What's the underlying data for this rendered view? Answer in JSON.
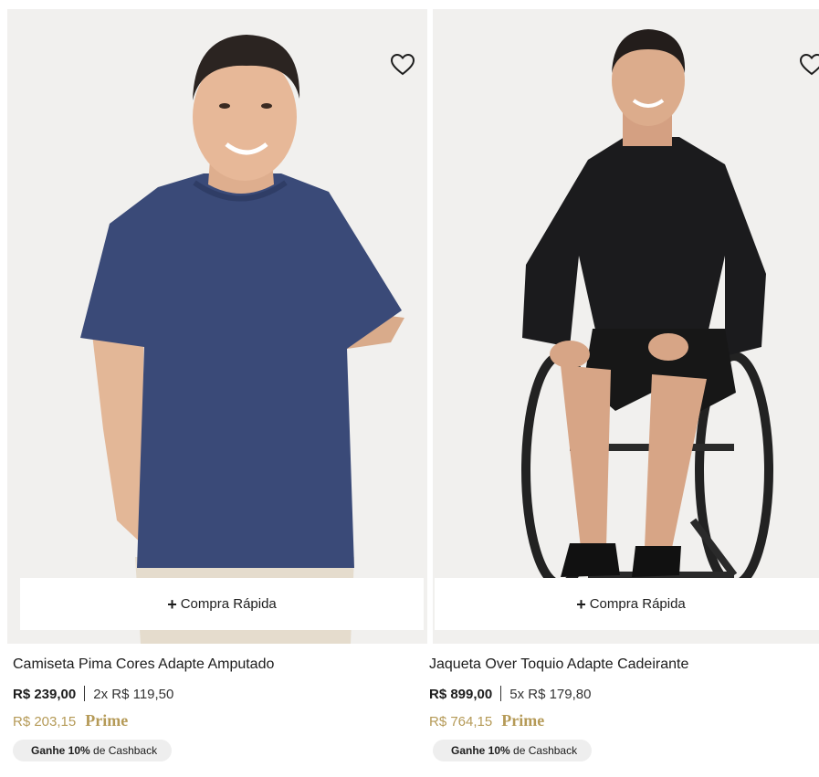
{
  "products": [
    {
      "name": "Camiseta Pima Cores Adapte Amputado",
      "quick_buy_label": "Compra Rápida",
      "price": "R$ 239,00",
      "installments": "2x R$ 119,50",
      "prime_price": "R$ 203,15",
      "prime_label": "Prime",
      "cashback_bold": "Ganhe 10%",
      "cashback_rest": "de Cashback",
      "favorite_icon": "heart-outline-icon"
    },
    {
      "name": "Jaqueta Over Toquio Adapte Cadeirante",
      "quick_buy_label": "Compra Rápida",
      "price": "R$ 899,00",
      "installments": "5x R$ 179,80",
      "prime_price": "R$ 764,15",
      "prime_label": "Prime",
      "cashback_bold": "Ganhe 10%",
      "cashback_rest": "de Cashback",
      "favorite_icon": "heart-outline-icon"
    }
  ],
  "colors": {
    "prime_gold": "#b59a57",
    "photo_background": "#f1f0ee",
    "cashback_badge": "#eeeeee",
    "text": "#1d1d1d"
  }
}
